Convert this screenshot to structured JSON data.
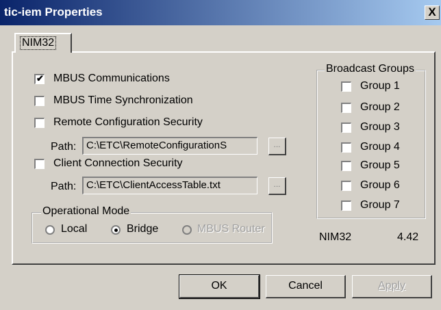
{
  "window": {
    "title": "tic-iem Properties",
    "close_glyph": "X"
  },
  "tabs": [
    {
      "label": "NIM32",
      "selected": true
    }
  ],
  "options": {
    "mbus_comm": {
      "label": "MBUS Communications",
      "checked": true,
      "check_glyph": "✔"
    },
    "mbus_time": {
      "label": "MBUS Time Synchronization",
      "checked": false
    },
    "remote_cfg": {
      "label": "Remote Configuration Security",
      "checked": false
    },
    "remote_path_label": "Path:",
    "remote_path_value": "C:\\ETC\\RemoteConfigurationS",
    "client_conn": {
      "label": "Client Connection Security",
      "checked": false
    },
    "client_path_label": "Path:",
    "client_path_value": "C:\\ETC\\ClientAccessTable.txt",
    "browse_label": "..."
  },
  "operational_mode": {
    "legend": "Operational Mode",
    "options": [
      {
        "label": "Local",
        "selected": false,
        "enabled": true
      },
      {
        "label": "Bridge",
        "selected": true,
        "enabled": true
      },
      {
        "label": "MBUS Router",
        "selected": false,
        "enabled": false
      }
    ]
  },
  "broadcast_groups": {
    "legend": "Broadcast Groups",
    "groups": [
      {
        "label": "Group 1",
        "checked": false
      },
      {
        "label": "Group 2",
        "checked": false
      },
      {
        "label": "Group 3",
        "checked": false
      },
      {
        "label": "Group 4",
        "checked": false
      },
      {
        "label": "Group 5",
        "checked": false
      },
      {
        "label": "Group 6",
        "checked": false
      },
      {
        "label": "Group 7",
        "checked": false
      }
    ]
  },
  "module": {
    "name": "NIM32",
    "version": "4.42"
  },
  "buttons": {
    "ok": "OK",
    "cancel": "Cancel",
    "apply": "Apply"
  }
}
